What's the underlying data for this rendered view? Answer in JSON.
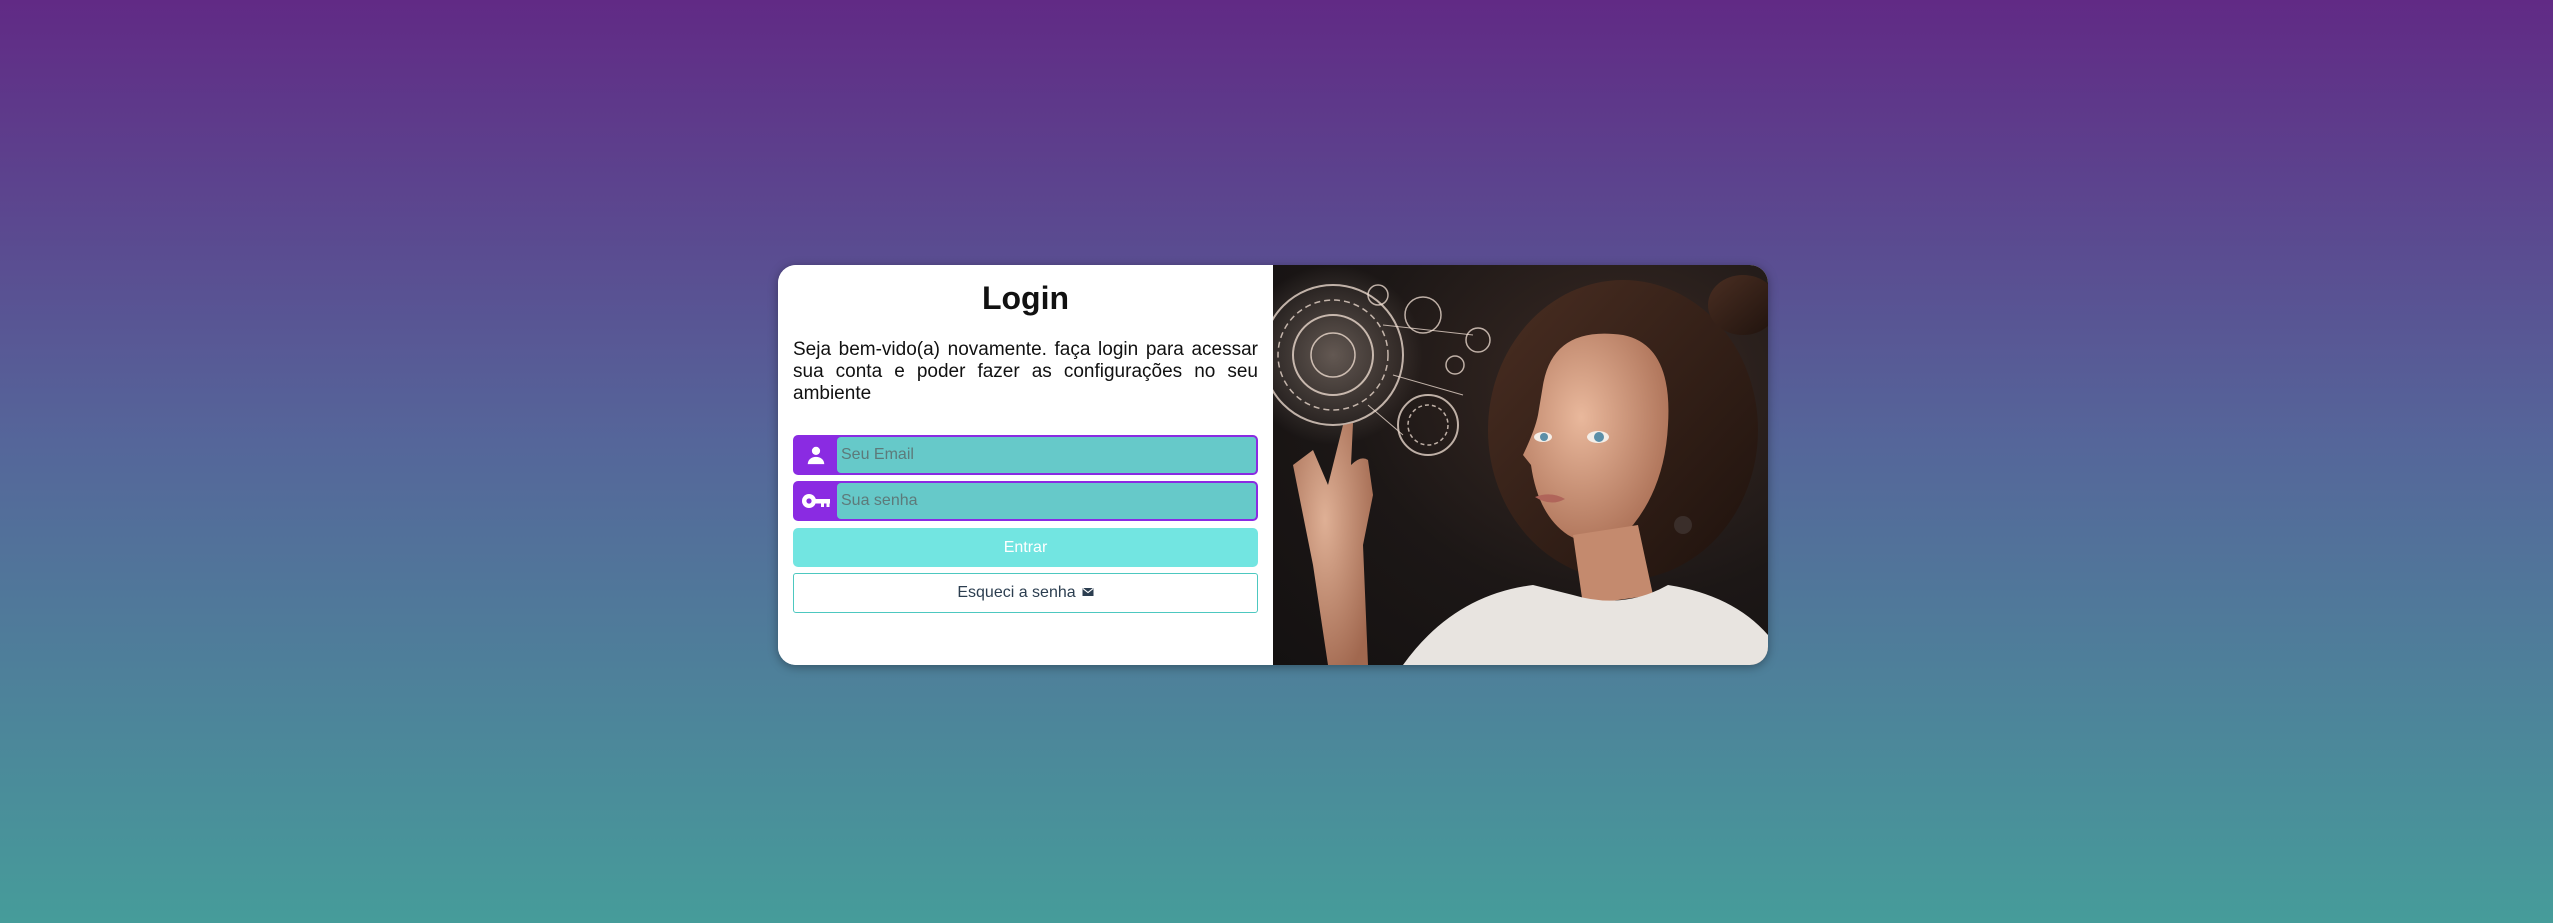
{
  "login": {
    "title": "Login",
    "intro": "Seja bem-vido(a) novamente. faça login para acessar sua conta e poder fazer as configurações no seu ambiente",
    "email": {
      "placeholder": "Seu Email",
      "value": "",
      "icon": "user-icon"
    },
    "password": {
      "placeholder": "Sua senha",
      "value": "",
      "icon": "key-icon"
    },
    "submit_label": "Entrar",
    "forgot_label": "Esqueci a senha",
    "forgot_icon": "envelope-icon"
  },
  "colors": {
    "accent": "#8a2be2",
    "input_bg": "#66c9c9",
    "button_bg": "#72e5e1",
    "forgot_border": "#4dc8c0",
    "bg_top": "#612a85",
    "bg_bottom": "#469c9a"
  },
  "photo": {
    "subject": "woman-touching-holographic-interface"
  }
}
